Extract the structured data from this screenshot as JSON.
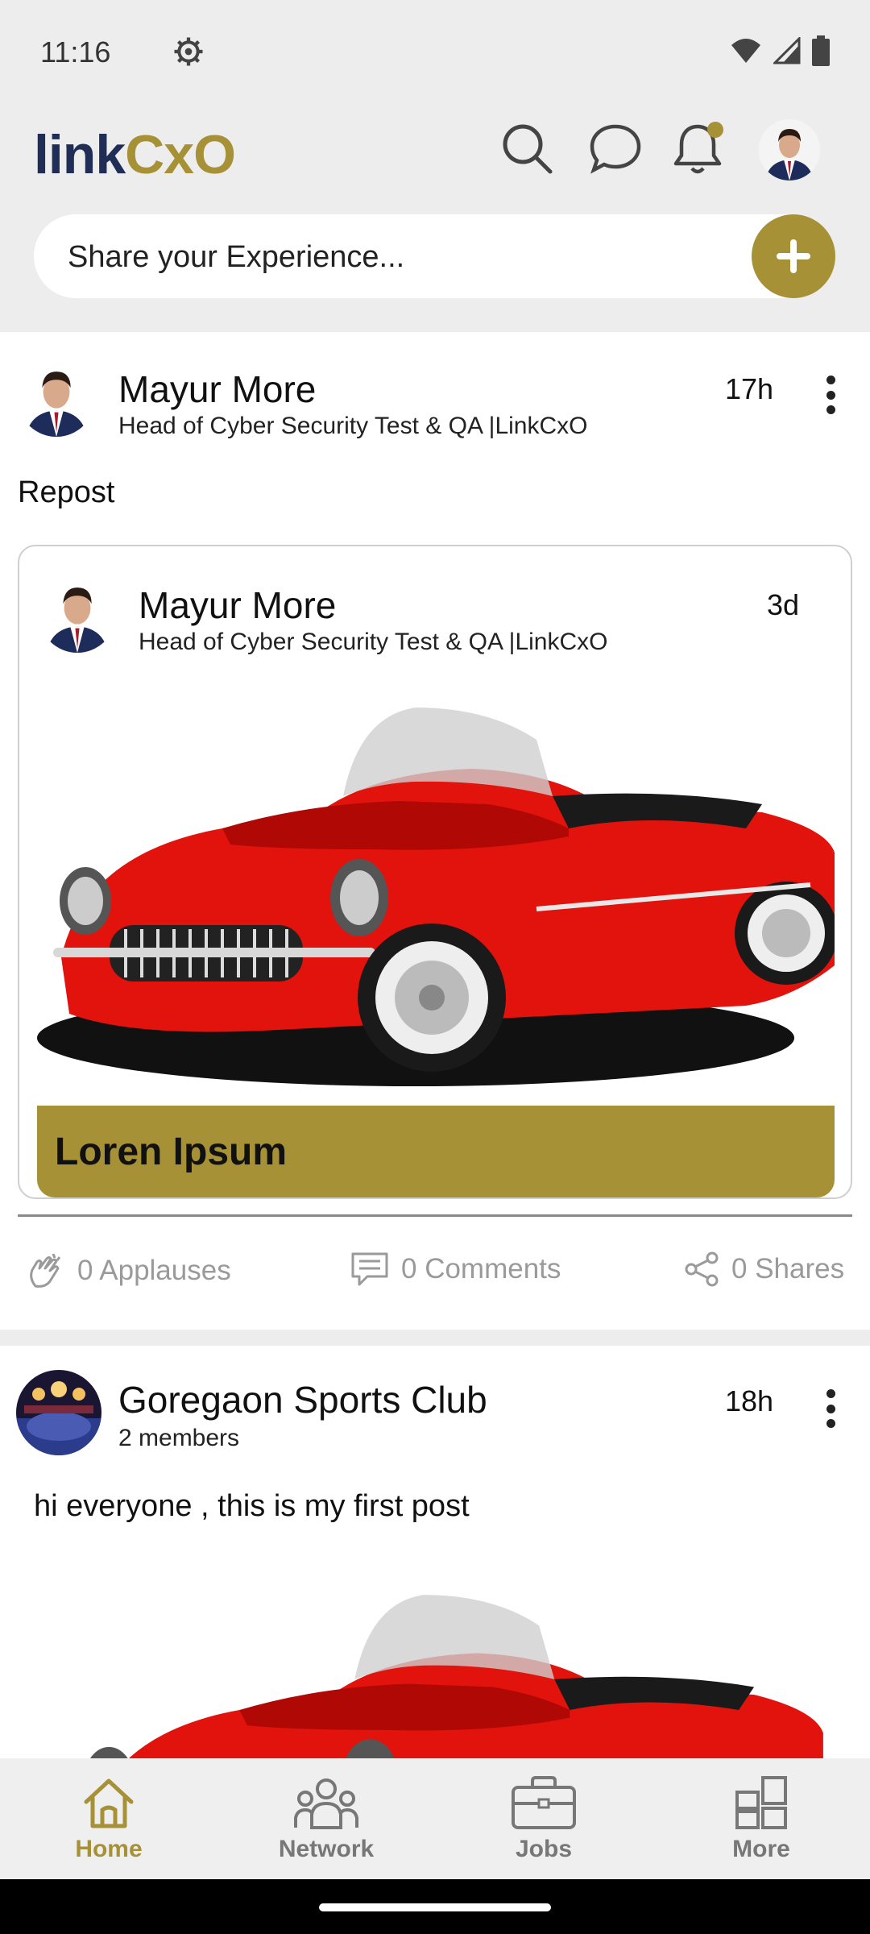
{
  "status_bar": {
    "time": "11:16",
    "icons": [
      "settings-gear-icon",
      "wifi-icon",
      "signal-icon",
      "battery-icon"
    ]
  },
  "header": {
    "logo_link": "link",
    "logo_cxo": "CxO",
    "icons": [
      "search-icon",
      "chat-icon",
      "notification-bell-icon",
      "profile-avatar"
    ]
  },
  "share": {
    "placeholder": "Share your Experience...",
    "add_icon": "plus-icon"
  },
  "posts": [
    {
      "author": "Mayur More",
      "title": "Head of Cyber Security Test & QA |LinkCxO",
      "time": "17h",
      "text": "Repost",
      "repost": {
        "author": "Mayur More",
        "title": "Head of Cyber Security Test & QA |LinkCxO",
        "time": "3d",
        "caption": "Loren Ipsum"
      },
      "actions": {
        "applauses": "0 Applauses",
        "comments": "0 Comments",
        "shares": "0 Shares"
      }
    },
    {
      "author": "Goregaon Sports Club",
      "subtitle": "2 members",
      "time": "18h",
      "text": "hi everyone , this is my first post"
    }
  ],
  "nav": {
    "items": [
      {
        "label": "Home",
        "icon": "home-icon",
        "active": true
      },
      {
        "label": "Network",
        "icon": "network-icon",
        "active": false
      },
      {
        "label": "Jobs",
        "icon": "briefcase-icon",
        "active": false
      },
      {
        "label": "More",
        "icon": "grid-icon",
        "active": false
      }
    ]
  },
  "colors": {
    "accent": "#a69137",
    "brand_navy": "#1f2d57",
    "background": "#ededed"
  }
}
